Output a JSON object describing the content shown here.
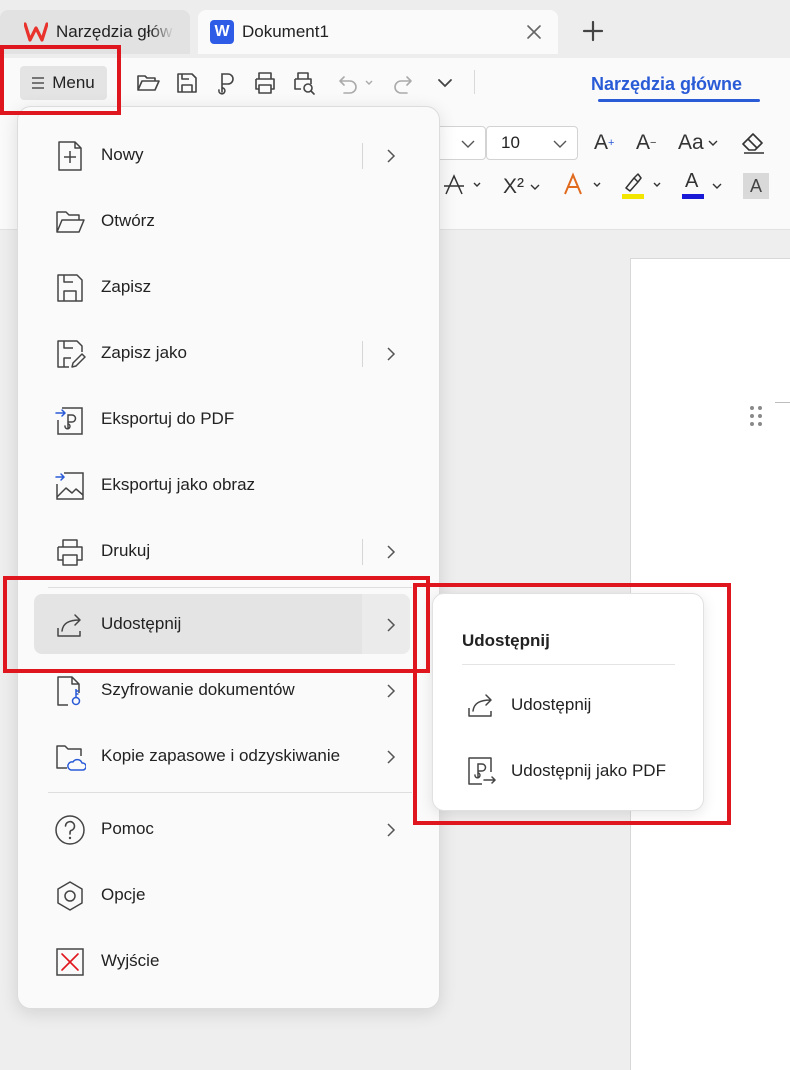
{
  "tabs": [
    {
      "label": "Narzędzia głów"
    },
    {
      "label": "Dokument1",
      "logo": "W"
    }
  ],
  "toolbar": {
    "menu_label": "Menu",
    "home_tab_label": "Narzędzia główne"
  },
  "ribbon": {
    "font_size": "10",
    "superscript_label": "X²",
    "increase_font": "A",
    "decrease_font": "A",
    "change_case": "Aa",
    "font_color_label": "A",
    "char_shading_label": "A",
    "colors": {
      "highlight": "#f2e600",
      "font_color": "#1a1ad6"
    }
  },
  "menu": {
    "items": [
      {
        "label": "Nowy",
        "icon": "new-document-icon",
        "submenu": true
      },
      {
        "label": "Otwórz",
        "icon": "folder-open-icon",
        "submenu": false
      },
      {
        "label": "Zapisz",
        "icon": "save-icon",
        "submenu": false
      },
      {
        "label": "Zapisz jako",
        "icon": "save-as-icon",
        "submenu": true
      },
      {
        "label": "Eksportuj do PDF",
        "icon": "export-pdf-icon",
        "submenu": false
      },
      {
        "label": "Eksportuj jako obraz",
        "icon": "export-image-icon",
        "submenu": false
      },
      {
        "label": "Drukuj",
        "icon": "print-icon",
        "submenu": true
      },
      {
        "label": "Udostępnij",
        "icon": "share-icon",
        "submenu": true,
        "active": true
      },
      {
        "label": "Szyfrowanie dokumentów",
        "icon": "encrypt-document-icon",
        "submenu": true
      },
      {
        "label": "Kopie zapasowe i odzyskiwanie",
        "icon": "backup-cloud-icon",
        "submenu": true
      },
      {
        "label": "Pomoc",
        "icon": "help-icon",
        "submenu": true
      },
      {
        "label": "Opcje",
        "icon": "options-icon",
        "submenu": false
      },
      {
        "label": "Wyjście",
        "icon": "exit-icon",
        "submenu": false
      }
    ]
  },
  "submenu": {
    "title": "Udostępnij",
    "items": [
      {
        "label": "Udostępnij",
        "icon": "share-icon"
      },
      {
        "label": "Udostępnij jako PDF",
        "icon": "share-pdf-icon"
      }
    ]
  },
  "colors": {
    "accent": "#2a5bd7",
    "annotation": "#e0161e",
    "brand_red": "#e8322b"
  }
}
